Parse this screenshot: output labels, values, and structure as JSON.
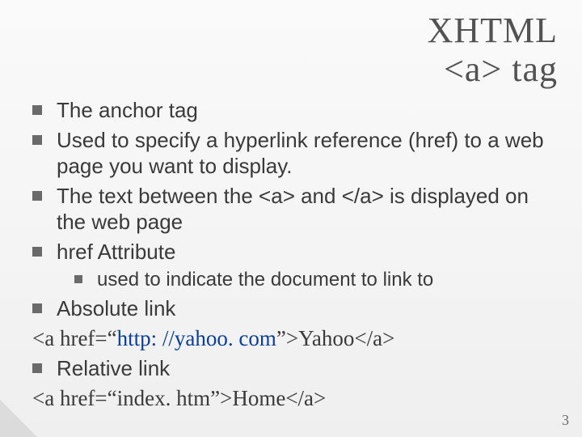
{
  "title_line1": "XHTML",
  "title_line2": "<a> tag",
  "bullets": {
    "b1": "The anchor tag",
    "b2": "Used to specify a hyperlink reference (href) to a web page you want to display.",
    "b3": "The text between the <a> and </a> is displayed on the web page",
    "b4": "href Attribute",
    "b4a": "used to indicate the document to link to",
    "b5": "Absolute link",
    "code1_pre": "<a href=“",
    "code1_url": "http: //yahoo. com",
    "code1_post": "”>Yahoo</a>",
    "b6": "Relative link",
    "code2": "<a href=“index. htm”>Home</a>"
  },
  "slide_number": "3"
}
